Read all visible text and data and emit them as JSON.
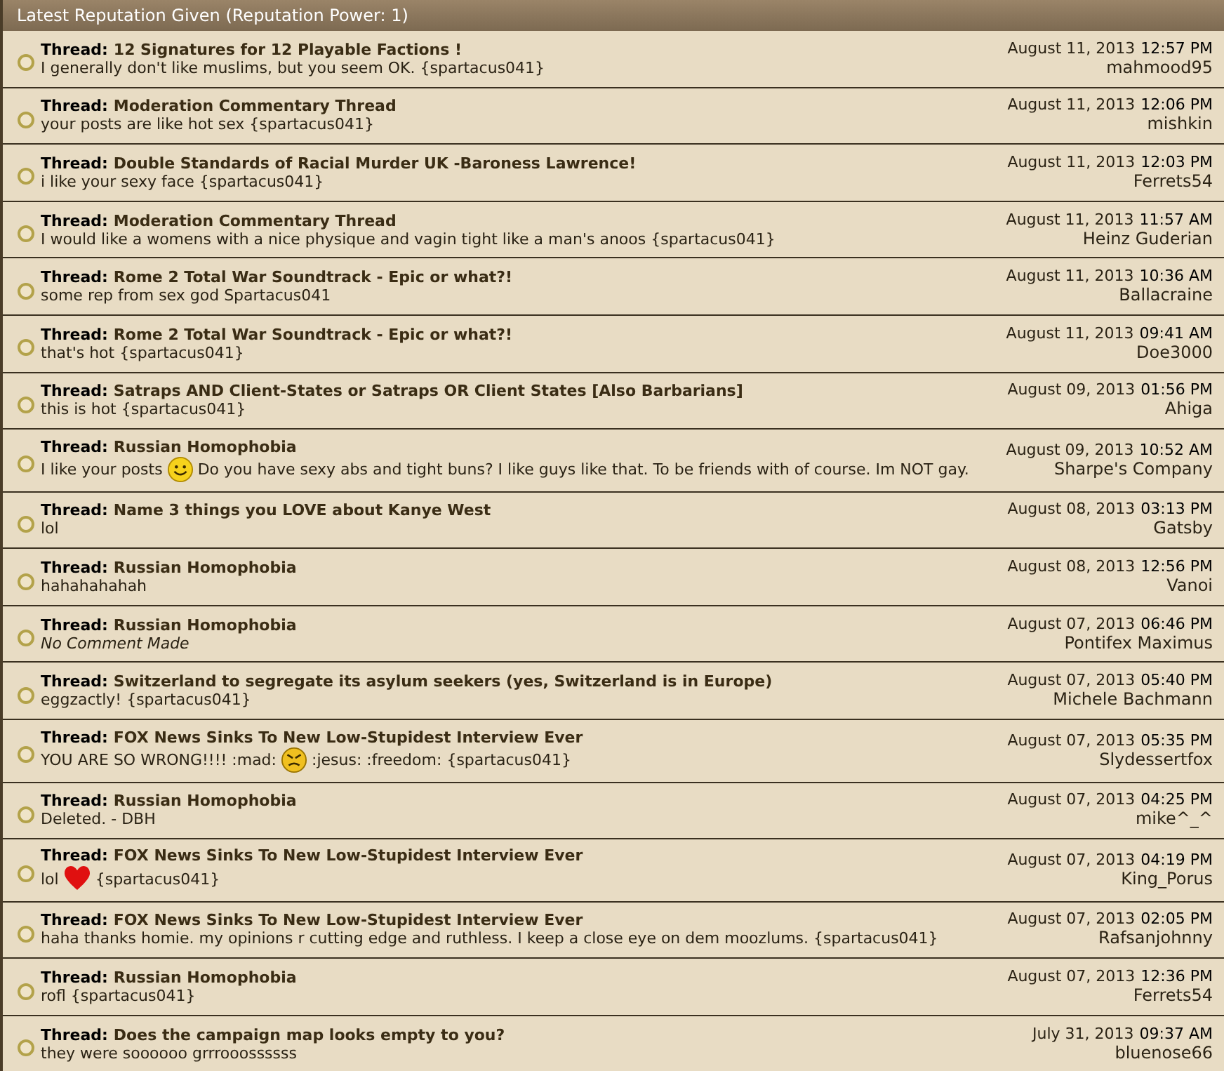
{
  "header": {
    "title": "Latest Reputation Given (Reputation Power: 1)"
  },
  "rows": [
    {
      "label": "Thread:",
      "thread": "12 Signatures for 12 Playable Factions !",
      "comment": [
        {
          "kind": "text",
          "text": "I generally don't like muslims, but you seem OK. {spartacus041}"
        }
      ],
      "date": "August 11, 2013",
      "time": "12:57 PM",
      "user": "mahmood95"
    },
    {
      "label": "Thread:",
      "thread": "Moderation Commentary Thread",
      "comment": [
        {
          "kind": "text",
          "text": "your posts are like hot sex {spartacus041}"
        }
      ],
      "date": "August 11, 2013",
      "time": "12:06 PM",
      "user": "mishkin"
    },
    {
      "label": "Thread:",
      "thread": "Double Standards of Racial Murder UK -Baroness Lawrence!",
      "comment": [
        {
          "kind": "text",
          "text": "i like your sexy face {spartacus041}"
        }
      ],
      "date": "August 11, 2013",
      "time": "12:03 PM",
      "user": "Ferrets54"
    },
    {
      "label": "Thread:",
      "thread": "Moderation Commentary Thread",
      "comment": [
        {
          "kind": "text",
          "text": "I would like a womens with a nice physique and vagin tight like a man's anoos {spartacus041}"
        }
      ],
      "date": "August 11, 2013",
      "time": "11:57 AM",
      "user": "Heinz Guderian"
    },
    {
      "label": "Thread:",
      "thread": "Rome 2 Total War Soundtrack - Epic or what?!",
      "comment": [
        {
          "kind": "text",
          "text": "some rep from sex god Spartacus041"
        }
      ],
      "date": "August 11, 2013",
      "time": "10:36 AM",
      "user": "Ballacraine"
    },
    {
      "label": "Thread:",
      "thread": "Rome 2 Total War Soundtrack - Epic or what?!",
      "comment": [
        {
          "kind": "text",
          "text": "that's hot {spartacus041}"
        }
      ],
      "date": "August 11, 2013",
      "time": "09:41 AM",
      "user": "Doe3000"
    },
    {
      "label": "Thread:",
      "thread": "Satraps AND Client-States or Satraps OR Client States [Also Barbarians]",
      "comment": [
        {
          "kind": "text",
          "text": "this is hot {spartacus041}"
        }
      ],
      "date": "August 09, 2013",
      "time": "01:56 PM",
      "user": "Ahiga"
    },
    {
      "label": "Thread:",
      "thread": "Russian Homophobia",
      "comment": [
        {
          "kind": "text",
          "text": "I like your posts"
        },
        {
          "kind": "smile"
        },
        {
          "kind": "text",
          "text": "Do you have sexy abs and tight buns? I like guys like that. To be friends with of course. Im NOT gay."
        }
      ],
      "date": "August 09, 2013",
      "time": "10:52 AM",
      "user": "Sharpe's Company"
    },
    {
      "label": "Thread:",
      "thread": "Name 3 things you LOVE about Kanye West",
      "comment": [
        {
          "kind": "text",
          "text": "lol"
        }
      ],
      "date": "August 08, 2013",
      "time": "03:13 PM",
      "user": "Gatsby"
    },
    {
      "label": "Thread:",
      "thread": "Russian Homophobia",
      "comment": [
        {
          "kind": "text",
          "text": "hahahahahah"
        }
      ],
      "date": "August 08, 2013",
      "time": "12:56 PM",
      "user": "Vanoi"
    },
    {
      "label": "Thread:",
      "thread": "Russian Homophobia",
      "comment": [
        {
          "kind": "italic",
          "text": "No Comment Made"
        }
      ],
      "date": "August 07, 2013",
      "time": "06:46 PM",
      "user": "Pontifex Maximus"
    },
    {
      "label": "Thread:",
      "thread": "Switzerland to segregate its asylum seekers (yes, Switzerland is in Europe)",
      "comment": [
        {
          "kind": "text",
          "text": "eggzactly! {spartacus041}"
        }
      ],
      "date": "August 07, 2013",
      "time": "05:40 PM",
      "user": "Michele Bachmann"
    },
    {
      "label": "Thread:",
      "thread": "FOX News Sinks To New Low-Stupidest Interview Ever",
      "comment": [
        {
          "kind": "text",
          "text": "YOU ARE SO WRONG!!!! :mad:"
        },
        {
          "kind": "angry"
        },
        {
          "kind": "text",
          "text": ":jesus: :freedom: {spartacus041}"
        }
      ],
      "date": "August 07, 2013",
      "time": "05:35 PM",
      "user": "Slydessertfox"
    },
    {
      "label": "Thread:",
      "thread": "Russian Homophobia",
      "comment": [
        {
          "kind": "text",
          "text": "Deleted. - DBH"
        }
      ],
      "date": "August 07, 2013",
      "time": "04:25 PM",
      "user": "mike^_^"
    },
    {
      "label": "Thread:",
      "thread": "FOX News Sinks To New Low-Stupidest Interview Ever",
      "comment": [
        {
          "kind": "text",
          "text": "lol"
        },
        {
          "kind": "heart"
        },
        {
          "kind": "text",
          "text": "{spartacus041}"
        }
      ],
      "date": "August 07, 2013",
      "time": "04:19 PM",
      "user": "King_Porus"
    },
    {
      "label": "Thread:",
      "thread": "FOX News Sinks To New Low-Stupidest Interview Ever",
      "comment": [
        {
          "kind": "text",
          "text": "haha thanks homie. my opinions r cutting edge and ruthless. I keep a close eye on dem moozlums. {spartacus041}"
        }
      ],
      "date": "August 07, 2013",
      "time": "02:05 PM",
      "user": "Rafsanjohnny"
    },
    {
      "label": "Thread:",
      "thread": "Russian Homophobia",
      "comment": [
        {
          "kind": "text",
          "text": "rofl {spartacus041}"
        }
      ],
      "date": "August 07, 2013",
      "time": "12:36 PM",
      "user": "Ferrets54"
    },
    {
      "label": "Thread:",
      "thread": "Does the campaign map looks empty to you?",
      "comment": [
        {
          "kind": "text",
          "text": "they were soooooo grrrooossssss"
        }
      ],
      "date": "July 31, 2013",
      "time": "09:37 AM",
      "user": "bluenose66"
    }
  ]
}
